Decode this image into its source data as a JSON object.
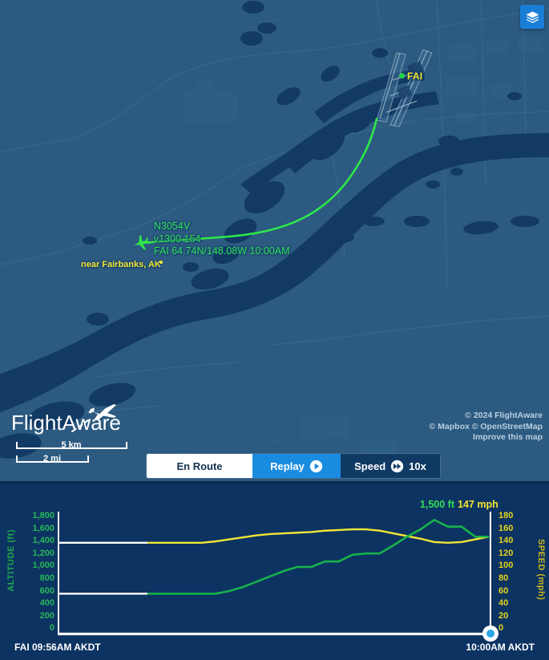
{
  "map": {
    "layers_button": {
      "icon": "layers-icon",
      "label": "Map layers"
    },
    "airport": {
      "code": "FAI",
      "marker": "airport-dot"
    },
    "aircraft": {
      "ident": "N3054V",
      "altspeed": "v1300 154",
      "position": "FAI 64.74N/148.08W 10:00AM",
      "near": "near Fairbanks, AK",
      "icon": "aircraft-icon"
    },
    "logo": {
      "text": "FlightAware",
      "icon": "flightaware-plane-icon"
    },
    "scale": {
      "km": "5 km",
      "mi": "2 mi"
    },
    "attribution": {
      "line1": "© 2024 FlightAware",
      "line2": "© Mapbox © OpenStreetMap",
      "line3": "Improve this map"
    },
    "colors": {
      "land": "#2c5a80",
      "water": "#123a64",
      "track": "#2ee84a",
      "airport_label": "#f2e636",
      "accent_blue": "#1a7ed6"
    }
  },
  "controls": {
    "status_label": "En Route",
    "replay_label": "Replay",
    "replay_icon": "play-icon",
    "speed_label": "Speed",
    "speed_icon": "fast-forward-icon",
    "speed_value": "10x"
  },
  "chart_readout": {
    "altitude": "1,500 ft",
    "speed": "147 mph"
  },
  "chart_times": {
    "start": "FAI 09:56AM AKDT",
    "end": "10:00AM AKDT"
  },
  "chart_data": {
    "type": "line",
    "title": "",
    "xlabel": "",
    "grid": false,
    "legend_position": "top-right",
    "x": [
      0,
      4,
      8,
      12,
      16,
      20,
      24,
      28,
      32,
      36,
      40,
      44,
      48,
      52,
      56,
      60,
      64,
      68,
      72,
      76,
      80,
      84,
      88,
      92,
      96,
      100
    ],
    "xlim": [
      0,
      100
    ],
    "x_start_label": "FAI 09:56AM AKDT",
    "x_end_label": "10:00AM AKDT",
    "series": [
      {
        "name": "Altitude",
        "unit": "ft",
        "color": "#18b24a",
        "axis": "left",
        "ylabel": "ALTITUDE (ft)",
        "ylim": [
          0,
          1800
        ],
        "yticks": [
          1800,
          1600,
          1400,
          1200,
          1000,
          800,
          600,
          400,
          200,
          0
        ],
        "current_value": 1500,
        "baseline_value": 600,
        "values": [
          600,
          600,
          600,
          600,
          600,
          600,
          640,
          700,
          780,
          860,
          940,
          1000,
          1000,
          1080,
          1080,
          1180,
          1200,
          1200,
          1320,
          1450,
          1560,
          1700,
          1600,
          1600,
          1450,
          1450
        ]
      },
      {
        "name": "Speed",
        "unit": "mph",
        "color": "#f2e636",
        "axis": "right",
        "ylabel": "SPEED (mph)",
        "ylim": [
          0,
          180
        ],
        "yticks": [
          180,
          160,
          140,
          120,
          100,
          80,
          60,
          40,
          20,
          0
        ],
        "current_value": 147,
        "baseline_value": 136,
        "values": [
          136,
          136,
          136,
          136,
          136,
          138,
          141,
          144,
          147,
          149,
          150,
          151,
          152,
          154,
          155,
          156,
          156,
          154,
          150,
          146,
          142,
          137,
          136,
          137,
          141,
          145
        ]
      }
    ],
    "playhead": {
      "x": 100,
      "color": "#2aa8e8"
    }
  }
}
